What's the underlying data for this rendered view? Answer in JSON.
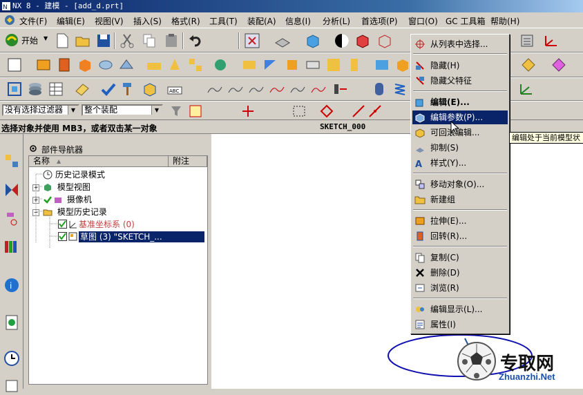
{
  "titlebar": {
    "text": "NX 8 - 建模 - [add_d.prt]"
  },
  "menubar": {
    "items": [
      "文件(F)",
      "编辑(E)",
      "视图(V)",
      "插入(S)",
      "格式(R)",
      "工具(T)",
      "装配(A)",
      "信息(I)",
      "分析(L)",
      "首选项(P)",
      "窗口(O)",
      "GC 工具箱",
      "帮助(H)"
    ]
  },
  "toolbar": {
    "start_label": "开始"
  },
  "selectionbar": {
    "filter_value": "没有选择过滤器",
    "scope_value": "整个装配"
  },
  "status": {
    "prompt": "选择对象并使用 MB3，或者双击某一对象",
    "sketch": "SKETCH_000"
  },
  "navigator": {
    "title": "部件导航器",
    "columns": [
      "名称",
      "附注"
    ],
    "items": [
      {
        "label": "历史记录模式"
      },
      {
        "label": "模型视图"
      },
      {
        "label": "摄像机"
      },
      {
        "label": "模型历史记录"
      },
      {
        "label": "基准坐标系 (0)"
      },
      {
        "label": "草图 (3) \"SKETCH_..."
      }
    ]
  },
  "contextmenu": {
    "items": [
      {
        "label": "从列表中选择...",
        "icon": "crosshair-icon"
      },
      {
        "label": "隐藏(H)",
        "icon": "hide-icon"
      },
      {
        "label": "隐藏父特征",
        "icon": "hide-parent-icon"
      },
      {
        "label": "编辑(E)...",
        "icon": "edit-icon"
      },
      {
        "label": "编辑参数(P)...",
        "icon": "edit-params-icon"
      },
      {
        "label": "可回滚编辑...",
        "icon": "rollback-edit-icon"
      },
      {
        "label": "抑制(S)",
        "icon": "suppress-icon"
      },
      {
        "label": "样式(Y)...",
        "icon": "style-icon"
      },
      {
        "label": "移动对象(O)...",
        "icon": "move-object-icon"
      },
      {
        "label": "新建组",
        "icon": "folder-icon"
      },
      {
        "label": "拉伸(E)...",
        "icon": "extrude-icon"
      },
      {
        "label": "回转(R)...",
        "icon": "revolve-icon"
      },
      {
        "label": "复制(C)",
        "icon": "copy-icon"
      },
      {
        "label": "删除(D)",
        "icon": "delete-icon"
      },
      {
        "label": "浏览(R)",
        "icon": "browse-icon"
      },
      {
        "label": "编辑显示(L)...",
        "icon": "edit-display-icon"
      },
      {
        "label": "属性(I)",
        "icon": "properties-icon"
      }
    ]
  },
  "tooltip": {
    "text": "编辑处于当前模型状"
  },
  "watermark": {
    "title": "专取网",
    "url": "Zhuanzhi.Net"
  },
  "colors": {
    "accent": "#0a246a",
    "menu_bg": "#d4d0c8",
    "tooltip_bg": "#ffffe1",
    "highlight_text": "#c04040"
  }
}
